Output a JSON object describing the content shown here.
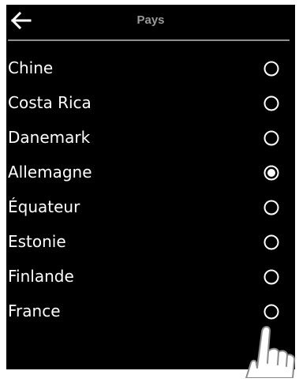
{
  "header": {
    "title": "Pays",
    "back_icon": "arrow-left-icon"
  },
  "countries": [
    {
      "label": "Chine",
      "selected": false
    },
    {
      "label": "Costa Rica",
      "selected": false
    },
    {
      "label": "Danemark",
      "selected": false
    },
    {
      "label": "Allemagne",
      "selected": true
    },
    {
      "label": "Équateur",
      "selected": false
    },
    {
      "label": "Estonie",
      "selected": false
    },
    {
      "label": "Finlande",
      "selected": false
    },
    {
      "label": "France",
      "selected": false
    }
  ],
  "colors": {
    "screen_background": "#000000",
    "text": "#ffffff",
    "title": "#9a9a9a",
    "divider": "#8f8f8f"
  }
}
